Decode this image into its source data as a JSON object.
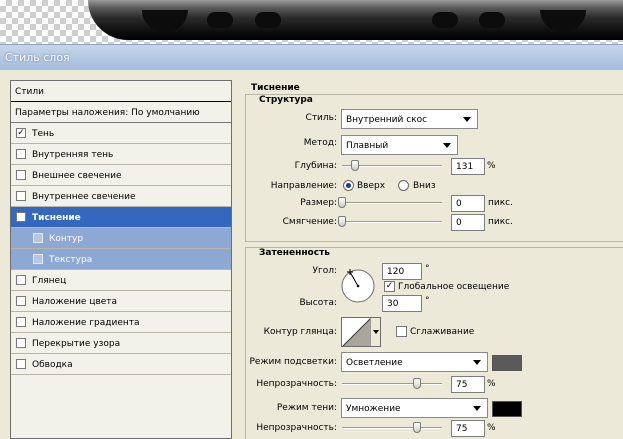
{
  "window": {
    "title": "Стиль слоя"
  },
  "left": {
    "header": "Стили",
    "params": "Параметры наложения: По умолчанию",
    "items": [
      {
        "label": "Тень",
        "checked": "✓"
      },
      {
        "label": "Внутренняя тень",
        "checked": ""
      },
      {
        "label": "Внешнее свечение",
        "checked": ""
      },
      {
        "label": "Внутреннее свечение",
        "checked": ""
      },
      {
        "label": "Тиснение",
        "checked": "✓"
      },
      {
        "label": "Контур",
        "checked": ""
      },
      {
        "label": "Текстура",
        "checked": ""
      },
      {
        "label": "Глянец",
        "checked": ""
      },
      {
        "label": "Наложение цвета",
        "checked": ""
      },
      {
        "label": "Наложение градиента",
        "checked": ""
      },
      {
        "label": "Перекрытие узора",
        "checked": ""
      },
      {
        "label": "Обводка",
        "checked": ""
      }
    ]
  },
  "emboss": {
    "title": "Тиснение",
    "structure": {
      "title": "Структура",
      "style_label": "Стиль:",
      "style_value": "Внутренний скос",
      "method_label": "Метод:",
      "method_value": "Плавный",
      "depth_label": "Глубина:",
      "depth_value": "131",
      "depth_unit": "%",
      "depth_slider": 0.13,
      "direction_label": "Направление:",
      "dir_up": "Вверх",
      "dir_down": "Вниз",
      "size_label": "Размер:",
      "size_value": "0",
      "size_unit": "пикс.",
      "size_slider": 0,
      "soften_label": "Смягчение:",
      "soften_value": "0",
      "soften_unit": "пикс.",
      "soften_slider": 0
    },
    "shading": {
      "title": "Затененность",
      "angle_label": "Угол:",
      "angle_value": "120",
      "angle_unit": "°",
      "global_light": "Глобальное освещение",
      "altitude_label": "Высота:",
      "altitude_value": "30",
      "altitude_unit": "°",
      "gloss_label": "Контур глянца:",
      "antialias": "Сглаживание",
      "highlight_label": "Режим подсветки:",
      "highlight_value": "Осветление",
      "highlight_color": "#5a5a5a",
      "opacity1_label": "Непрозрачность:",
      "opacity1_value": "75",
      "opacity1_unit": "%",
      "opacity1_slider": 0.75,
      "shadow_label": "Режим тени:",
      "shadow_value": "Умножение",
      "shadow_color": "#000000",
      "opacity2_label": "Непрозрачность:",
      "opacity2_value": "75",
      "opacity2_unit": "%",
      "opacity2_slider": 0.75
    }
  }
}
